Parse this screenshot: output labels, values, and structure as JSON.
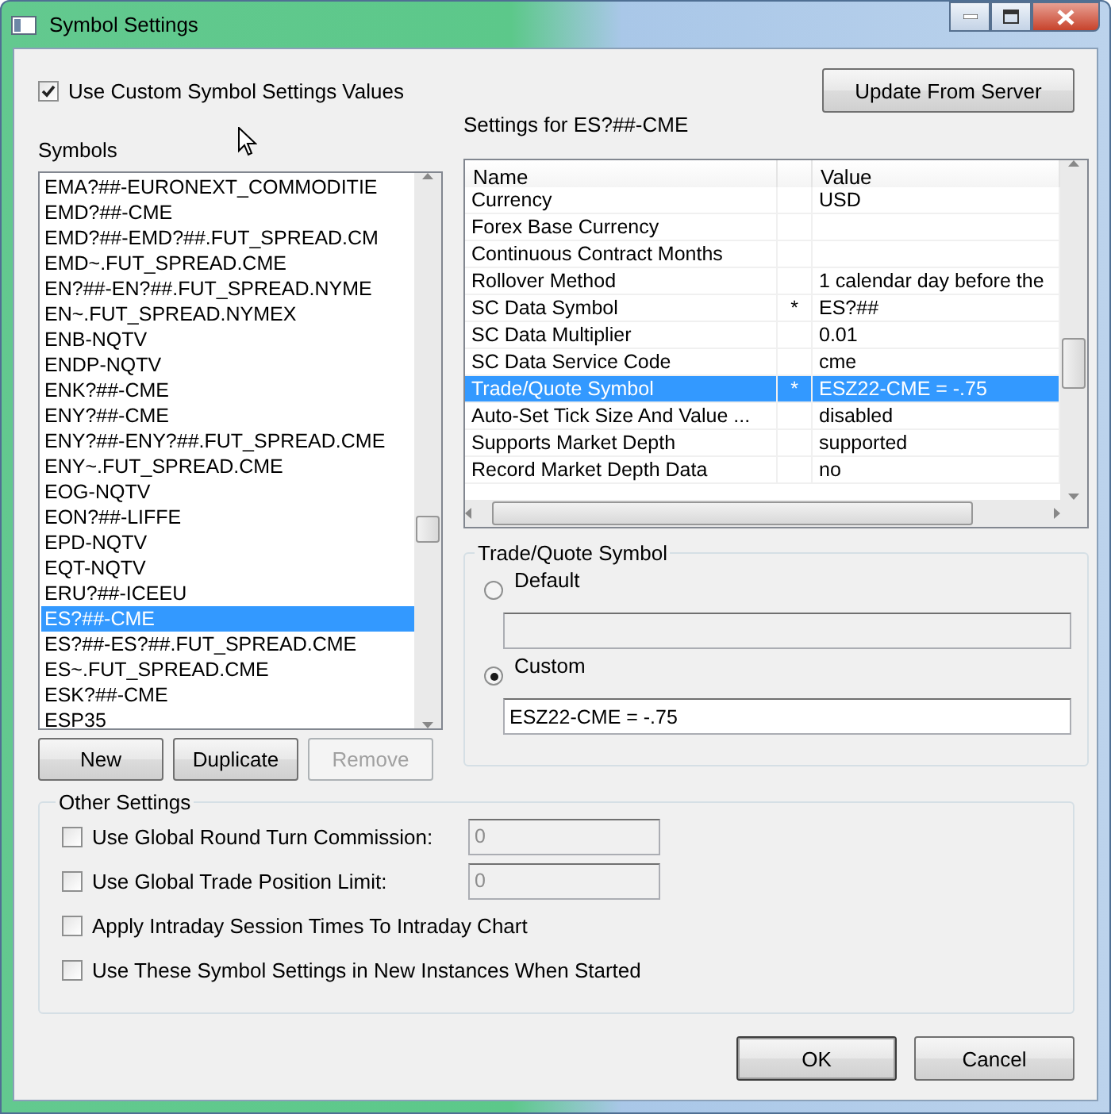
{
  "window": {
    "title": "Symbol Settings"
  },
  "use_custom": {
    "label": "Use Custom Symbol Settings Values",
    "checked": true
  },
  "update_button": "Update From Server",
  "symbols": {
    "label": "Symbols",
    "items": [
      {
        "text": "EMA?##-EURONEXT_COMMODITIE",
        "selected": false
      },
      {
        "text": "EMD?##-CME",
        "selected": false
      },
      {
        "text": "EMD?##-EMD?##.FUT_SPREAD.CM",
        "selected": false
      },
      {
        "text": "EMD~.FUT_SPREAD.CME",
        "selected": false
      },
      {
        "text": "EN?##-EN?##.FUT_SPREAD.NYME",
        "selected": false
      },
      {
        "text": "EN~.FUT_SPREAD.NYMEX",
        "selected": false
      },
      {
        "text": "ENB-NQTV",
        "selected": false
      },
      {
        "text": "ENDP-NQTV",
        "selected": false
      },
      {
        "text": "ENK?##-CME",
        "selected": false
      },
      {
        "text": "ENY?##-CME",
        "selected": false
      },
      {
        "text": "ENY?##-ENY?##.FUT_SPREAD.CME",
        "selected": false
      },
      {
        "text": "ENY~.FUT_SPREAD.CME",
        "selected": false
      },
      {
        "text": "EOG-NQTV",
        "selected": false
      },
      {
        "text": "EON?##-LIFFE",
        "selected": false
      },
      {
        "text": "EPD-NQTV",
        "selected": false
      },
      {
        "text": "EQT-NQTV",
        "selected": false
      },
      {
        "text": "ERU?##-ICEEU",
        "selected": false
      },
      {
        "text": "ES?##-CME",
        "selected": true
      },
      {
        "text": "ES?##-ES?##.FUT_SPREAD.CME",
        "selected": false
      },
      {
        "text": "ES~.FUT_SPREAD.CME",
        "selected": false
      },
      {
        "text": "ESK?##-CME",
        "selected": false
      },
      {
        "text": "ESP35",
        "selected": false
      }
    ]
  },
  "symbol_buttons": [
    {
      "label": "New",
      "disabled": false
    },
    {
      "label": "Duplicate",
      "disabled": false
    },
    {
      "label": "Remove",
      "disabled": true
    }
  ],
  "settings": {
    "title": "Settings for ES?##-CME",
    "columns": [
      "Name",
      "Value"
    ],
    "rows": [
      {
        "name": "Currency",
        "value": "USD",
        "selected": false
      },
      {
        "name": "Forex Base Currency",
        "selected": false
      },
      {
        "name": "Continuous Contract Months",
        "selected": false
      },
      {
        "name": "Rollover Method",
        "value": "1 calendar day before the",
        "selected": false
      },
      {
        "name": "SC Data Symbol",
        "flag": "*",
        "value": "ES?##",
        "selected": false
      },
      {
        "name": "SC Data Multiplier",
        "value": "0.01",
        "selected": false
      },
      {
        "name": "SC Data Service Code",
        "value": "cme",
        "selected": false
      },
      {
        "name": "Trade/Quote Symbol",
        "flag": "*",
        "value": "ESZ22-CME = -.75",
        "selected": true
      },
      {
        "name": "Auto-Set Tick Size And Value ...",
        "value": "disabled",
        "selected": false
      },
      {
        "name": "Supports Market Depth",
        "value": "supported",
        "selected": false
      },
      {
        "name": "Record Market Depth Data",
        "value": "no",
        "selected": false
      }
    ]
  },
  "trade_quote": {
    "title": "Trade/Quote Symbol",
    "options": [
      {
        "label": "Default",
        "selected": false,
        "disabled": true
      },
      {
        "label": "Custom",
        "selected": true,
        "disabled": false,
        "value": "ESZ22-CME = -.75"
      }
    ]
  },
  "other_settings": {
    "title": "Other Settings",
    "items": [
      {
        "label": "Use Global Round Turn Commission:",
        "checked": false,
        "value": "0"
      },
      {
        "label": "Use Global Trade Position Limit:",
        "checked": false,
        "value": "0"
      },
      {
        "label": "Apply Intraday Session Times To Intraday Chart",
        "checked": false
      },
      {
        "label": "Use These Symbol Settings in New Instances When Started",
        "checked": false
      }
    ]
  },
  "buttons": [
    {
      "label": "OK",
      "default": true
    },
    {
      "label": "Cancel",
      "default": false
    }
  ]
}
